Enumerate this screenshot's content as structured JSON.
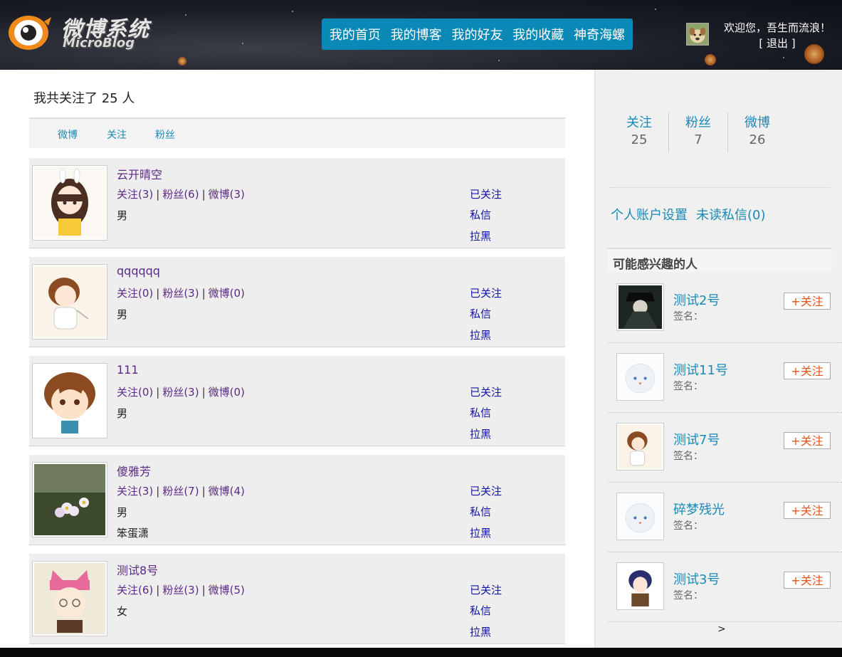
{
  "logo": {
    "title": "微博系统",
    "subtitle": "MicroBlog"
  },
  "nav": {
    "items": [
      "我的首页",
      "我的博客",
      "我的好友",
      "我的收藏",
      "神奇海螺"
    ]
  },
  "header": {
    "welcome": "欢迎您，吾生而流浪！",
    "logout": "[ 退出 ]"
  },
  "main": {
    "count_title": "我共关注了 25 人",
    "tabs": [
      "微博",
      "关注",
      "粉丝"
    ],
    "users": [
      {
        "name": "云开晴空",
        "follow": "关注(3)",
        "fans": "粉丝(6)",
        "blogs": "微博(3)",
        "gender": "男",
        "signature": "",
        "status": "已关注",
        "message": "私信",
        "block": "拉黑"
      },
      {
        "name": "qqqqqq",
        "follow": "关注(0)",
        "fans": "粉丝(3)",
        "blogs": "微博(0)",
        "gender": "男",
        "signature": "",
        "status": "已关注",
        "message": "私信",
        "block": "拉黑"
      },
      {
        "name": "111",
        "follow": "关注(0)",
        "fans": "粉丝(3)",
        "blogs": "微博(0)",
        "gender": "男",
        "signature": "",
        "status": "已关注",
        "message": "私信",
        "block": "拉黑"
      },
      {
        "name": "傻雅芳",
        "follow": "关注(3)",
        "fans": "粉丝(7)",
        "blogs": "微博(4)",
        "gender": "男",
        "signature": "笨蛋潇",
        "status": "已关注",
        "message": "私信",
        "block": "拉黑"
      },
      {
        "name": "测试8号",
        "follow": "关注(6)",
        "fans": "粉丝(3)",
        "blogs": "微博(5)",
        "gender": "女",
        "signature": "",
        "status": "已关注",
        "message": "私信",
        "block": "拉黑"
      }
    ],
    "separator": "|"
  },
  "sidebar": {
    "stats": [
      {
        "label": "关注",
        "value": "25"
      },
      {
        "label": "粉丝",
        "value": "7"
      },
      {
        "label": "微博",
        "value": "26"
      }
    ],
    "links": [
      "个人账户设置",
      "未读私信(0)"
    ],
    "recommend_title": "可能感兴趣的人",
    "recommend": [
      {
        "name": "测试2号",
        "signature": "签名：",
        "button": "+关注"
      },
      {
        "name": "测试11号",
        "signature": "签名：",
        "button": "+关注"
      },
      {
        "name": "测试7号",
        "signature": "签名：",
        "button": "+关注"
      },
      {
        "name": "碎梦残光",
        "signature": "签名：",
        "button": "+关注"
      },
      {
        "name": "测试3号",
        "signature": "签名：",
        "button": "+关注"
      }
    ],
    "next": ">"
  },
  "colors": {
    "nav_bg": "#0a89b7",
    "link": "#1a8ab8",
    "username": "#5b2a86",
    "action": "#1111aa",
    "follow_button_text": "#e5541b"
  }
}
